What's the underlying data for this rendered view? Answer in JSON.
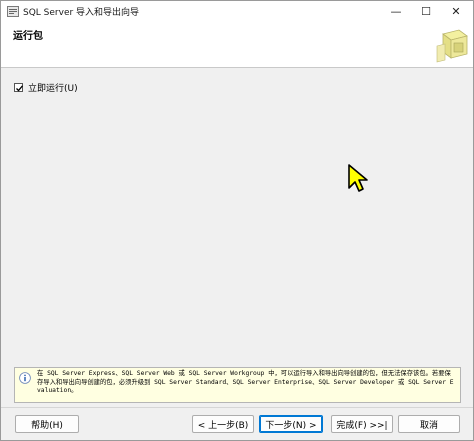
{
  "window": {
    "title": "SQL Server 导入和导出向导",
    "min_glyph": "—",
    "max_glyph": "☐",
    "close_glyph": "✕"
  },
  "header": {
    "title": "运行包"
  },
  "options": {
    "run_immediately": {
      "label": "立即运行(U)",
      "checked": true
    }
  },
  "info": {
    "text": "在 SQL Server Express、SQL Server Web 或 SQL Server Workgroup 中，可以运行导入和导出向导创建的包，但无法保存该包。若要保存导入和导出向导创建的包，必须升级到 SQL Server Standard、SQL Server Enterprise、SQL Server Developer 或 SQL Server Evaluation。"
  },
  "buttons": {
    "help": "帮助(H)",
    "back": "< 上一步(B)",
    "next": "下一步(N) >",
    "finish": "完成(F) >>|",
    "cancel": "取消"
  },
  "colors": {
    "info_background": "#ffffe1",
    "default_button_border": "#0078d4"
  }
}
